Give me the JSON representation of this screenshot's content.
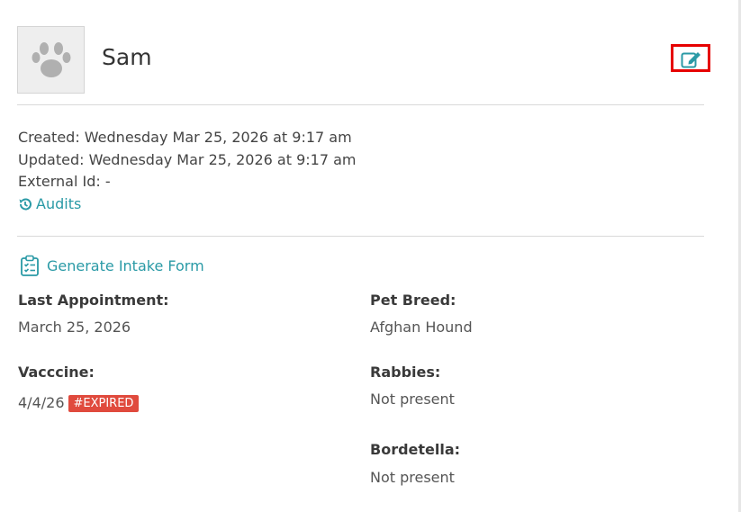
{
  "pet": {
    "name": "Sam",
    "avatar_icon": "paw-icon",
    "edit_icon": "edit-icon"
  },
  "meta": {
    "created": "Created: Wednesday Mar 25, 2026 at 9:17 am",
    "updated": "Updated: Wednesday Mar 25, 2026 at 9:17 am",
    "external_id": "External Id: -",
    "audits_label": "Audits",
    "audits_icon": "history-icon"
  },
  "intake": {
    "label": "Generate Intake Form",
    "icon": "clipboard-checklist-icon"
  },
  "fields": {
    "last_appointment": {
      "label": "Last Appointment:",
      "value": "March 25, 2026"
    },
    "pet_breed": {
      "label": "Pet Breed:",
      "value": "Afghan Hound"
    },
    "vaccine": {
      "label": "Vacccine:",
      "value": "4/4/26",
      "badge": "#EXPIRED"
    },
    "rabbies": {
      "label": "Rabbies:",
      "value": "Not present"
    },
    "bordetella": {
      "label": "Bordetella:",
      "value": "Not present"
    }
  },
  "colors": {
    "link": "#2a9aa6",
    "badge": "#e04a3d",
    "highlight_border": "#e60000"
  }
}
